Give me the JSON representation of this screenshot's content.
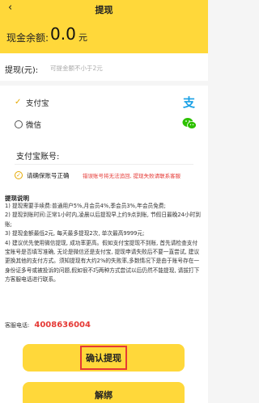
{
  "header": {
    "back_icon": "chevron-left-icon",
    "title": "提现",
    "balance_label": "现金余额:",
    "balance_value": "0.0",
    "balance_unit": "元",
    "bg_color": "#ffd83a"
  },
  "amount": {
    "label": "提现(元):",
    "placeholder": "可提金额不小于2元"
  },
  "payment": {
    "methods": [
      {
        "label": "支付宝",
        "selected": true,
        "icon": "alipay-icon"
      },
      {
        "label": "微信",
        "selected": false,
        "icon": "wechat-icon"
      }
    ],
    "account_label": "支付宝账号:",
    "confirm_label": "请确保账号正确",
    "warning": "错误账号将无法追回, 提现失败请联系客服"
  },
  "notes": {
    "title": "提现说明",
    "items": [
      "1) 提现需要手续费:普通用户5%,月会员4%,季会员3%,年会员免费;",
      "2) 提现到账时间:正常1小时内,凌晨以后提现早上约9点到账, 节假日最晚24小时到账;",
      "3) 提现金额最低2元, 每天最多提现2次, 单次最高9999元;",
      "4) 建议优先使用微信提现, 成功率更高。假如支付宝提现不到账, 首先请检查支付宝账号是否填写准确, 无论是微信还是支付宝, 提现申请失败后不要一直尝试, 建议更换其他的支付方式。须知提现有大约2%的失败率,多数情况下是由于账号存在一身份证多号或被投诉的问题,假如很不巧两种方式尝试以后仍然不能提现, 请拔打下方客服电话进行联系。"
    ],
    "phone_label": "客服电话:",
    "phone": "4008636004"
  },
  "buttons": {
    "confirm": "确认提现",
    "unbind": "解绑"
  },
  "colors": {
    "accent": "#ffd83a",
    "warning": "#e53935",
    "check": "#e5a800"
  }
}
